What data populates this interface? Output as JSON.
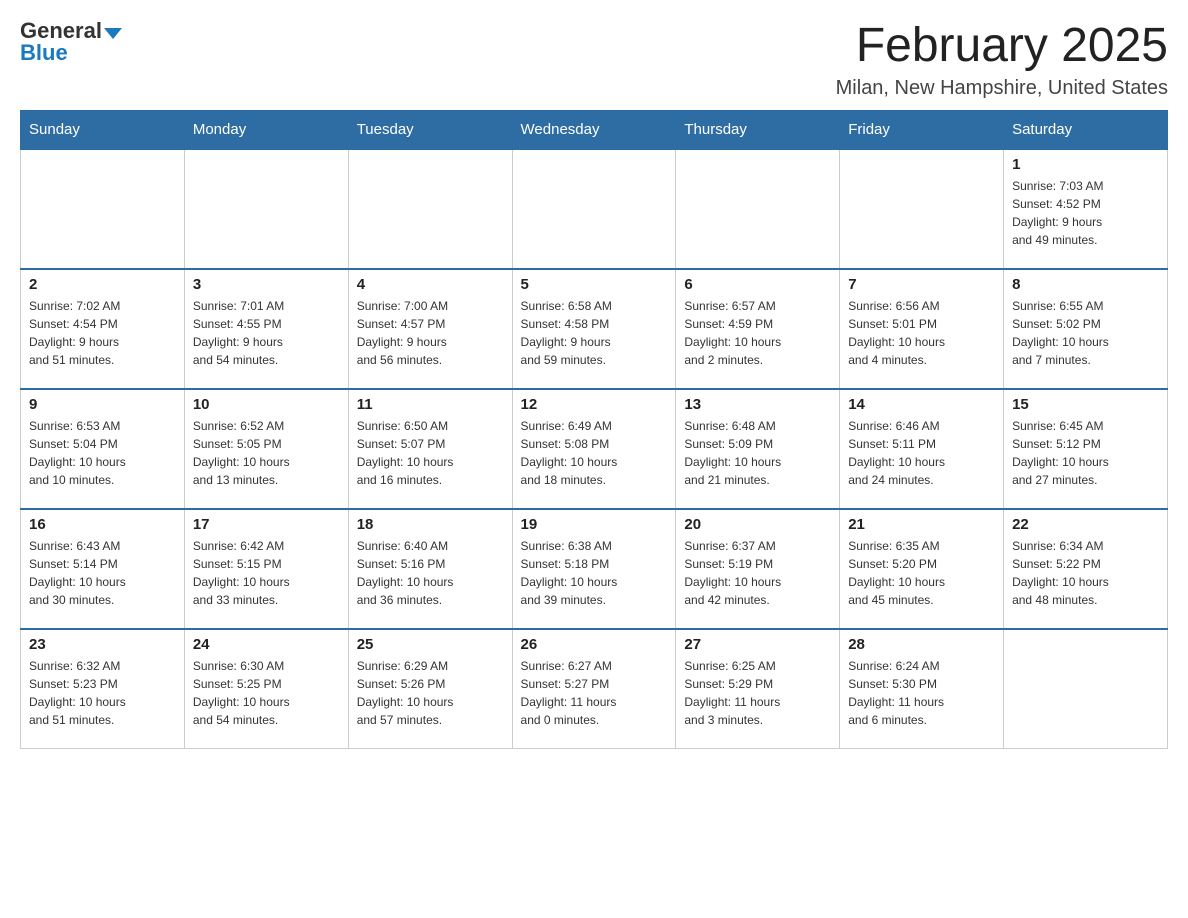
{
  "header": {
    "logo_general": "General",
    "logo_blue": "Blue",
    "month_title": "February 2025",
    "location": "Milan, New Hampshire, United States"
  },
  "weekdays": [
    "Sunday",
    "Monday",
    "Tuesday",
    "Wednesday",
    "Thursday",
    "Friday",
    "Saturday"
  ],
  "weeks": [
    [
      {
        "day": "",
        "info": ""
      },
      {
        "day": "",
        "info": ""
      },
      {
        "day": "",
        "info": ""
      },
      {
        "day": "",
        "info": ""
      },
      {
        "day": "",
        "info": ""
      },
      {
        "day": "",
        "info": ""
      },
      {
        "day": "1",
        "info": "Sunrise: 7:03 AM\nSunset: 4:52 PM\nDaylight: 9 hours\nand 49 minutes."
      }
    ],
    [
      {
        "day": "2",
        "info": "Sunrise: 7:02 AM\nSunset: 4:54 PM\nDaylight: 9 hours\nand 51 minutes."
      },
      {
        "day": "3",
        "info": "Sunrise: 7:01 AM\nSunset: 4:55 PM\nDaylight: 9 hours\nand 54 minutes."
      },
      {
        "day": "4",
        "info": "Sunrise: 7:00 AM\nSunset: 4:57 PM\nDaylight: 9 hours\nand 56 minutes."
      },
      {
        "day": "5",
        "info": "Sunrise: 6:58 AM\nSunset: 4:58 PM\nDaylight: 9 hours\nand 59 minutes."
      },
      {
        "day": "6",
        "info": "Sunrise: 6:57 AM\nSunset: 4:59 PM\nDaylight: 10 hours\nand 2 minutes."
      },
      {
        "day": "7",
        "info": "Sunrise: 6:56 AM\nSunset: 5:01 PM\nDaylight: 10 hours\nand 4 minutes."
      },
      {
        "day": "8",
        "info": "Sunrise: 6:55 AM\nSunset: 5:02 PM\nDaylight: 10 hours\nand 7 minutes."
      }
    ],
    [
      {
        "day": "9",
        "info": "Sunrise: 6:53 AM\nSunset: 5:04 PM\nDaylight: 10 hours\nand 10 minutes."
      },
      {
        "day": "10",
        "info": "Sunrise: 6:52 AM\nSunset: 5:05 PM\nDaylight: 10 hours\nand 13 minutes."
      },
      {
        "day": "11",
        "info": "Sunrise: 6:50 AM\nSunset: 5:07 PM\nDaylight: 10 hours\nand 16 minutes."
      },
      {
        "day": "12",
        "info": "Sunrise: 6:49 AM\nSunset: 5:08 PM\nDaylight: 10 hours\nand 18 minutes."
      },
      {
        "day": "13",
        "info": "Sunrise: 6:48 AM\nSunset: 5:09 PM\nDaylight: 10 hours\nand 21 minutes."
      },
      {
        "day": "14",
        "info": "Sunrise: 6:46 AM\nSunset: 5:11 PM\nDaylight: 10 hours\nand 24 minutes."
      },
      {
        "day": "15",
        "info": "Sunrise: 6:45 AM\nSunset: 5:12 PM\nDaylight: 10 hours\nand 27 minutes."
      }
    ],
    [
      {
        "day": "16",
        "info": "Sunrise: 6:43 AM\nSunset: 5:14 PM\nDaylight: 10 hours\nand 30 minutes."
      },
      {
        "day": "17",
        "info": "Sunrise: 6:42 AM\nSunset: 5:15 PM\nDaylight: 10 hours\nand 33 minutes."
      },
      {
        "day": "18",
        "info": "Sunrise: 6:40 AM\nSunset: 5:16 PM\nDaylight: 10 hours\nand 36 minutes."
      },
      {
        "day": "19",
        "info": "Sunrise: 6:38 AM\nSunset: 5:18 PM\nDaylight: 10 hours\nand 39 minutes."
      },
      {
        "day": "20",
        "info": "Sunrise: 6:37 AM\nSunset: 5:19 PM\nDaylight: 10 hours\nand 42 minutes."
      },
      {
        "day": "21",
        "info": "Sunrise: 6:35 AM\nSunset: 5:20 PM\nDaylight: 10 hours\nand 45 minutes."
      },
      {
        "day": "22",
        "info": "Sunrise: 6:34 AM\nSunset: 5:22 PM\nDaylight: 10 hours\nand 48 minutes."
      }
    ],
    [
      {
        "day": "23",
        "info": "Sunrise: 6:32 AM\nSunset: 5:23 PM\nDaylight: 10 hours\nand 51 minutes."
      },
      {
        "day": "24",
        "info": "Sunrise: 6:30 AM\nSunset: 5:25 PM\nDaylight: 10 hours\nand 54 minutes."
      },
      {
        "day": "25",
        "info": "Sunrise: 6:29 AM\nSunset: 5:26 PM\nDaylight: 10 hours\nand 57 minutes."
      },
      {
        "day": "26",
        "info": "Sunrise: 6:27 AM\nSunset: 5:27 PM\nDaylight: 11 hours\nand 0 minutes."
      },
      {
        "day": "27",
        "info": "Sunrise: 6:25 AM\nSunset: 5:29 PM\nDaylight: 11 hours\nand 3 minutes."
      },
      {
        "day": "28",
        "info": "Sunrise: 6:24 AM\nSunset: 5:30 PM\nDaylight: 11 hours\nand 6 minutes."
      },
      {
        "day": "",
        "info": ""
      }
    ]
  ]
}
